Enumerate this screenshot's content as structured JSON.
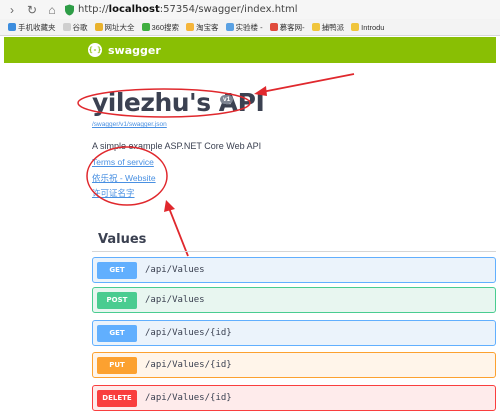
{
  "browser": {
    "url_prefix": "http://",
    "url_host": "localhost",
    "url_rest": ":57354/swagger/index.html"
  },
  "bookmarks": [
    {
      "label": "手机收藏夹",
      "color": "#3c8dde"
    },
    {
      "label": "谷歌",
      "color": "#cfcfcf"
    },
    {
      "label": "网址大全",
      "color": "#e9b22c"
    },
    {
      "label": "360搜索",
      "color": "#3fae3f"
    },
    {
      "label": "淘宝客",
      "color": "#f5b53a"
    },
    {
      "label": "实验楼 -",
      "color": "#5aa1e3"
    },
    {
      "label": "慕客网-",
      "color": "#e04b3c"
    },
    {
      "label": "捕鸭派",
      "color": "#f0c53c"
    },
    {
      "label": "Introdu",
      "color": "#f0c53c"
    }
  ],
  "topbar": {
    "brand": "swagger",
    "logo_glyph": "{-}",
    "color": "#89bf04"
  },
  "info": {
    "title": "yilezhu's API",
    "version": "v1",
    "spec_url": "/swagger/v1/swagger.json",
    "description": "A simple example ASP.NET Core Web API",
    "terms": "Terms of service",
    "contact": "依乐祝 - Website",
    "license": "许可证名字"
  },
  "section": {
    "title": "Values"
  },
  "operations": [
    {
      "method": "GET",
      "path": "/api/Values",
      "color": "#61affe",
      "bg": "#ebf3fb",
      "border": "#61affe"
    },
    {
      "method": "POST",
      "path": "/api/Values",
      "color": "#49cc90",
      "bg": "#e8f6f0",
      "border": "#49cc90"
    },
    {
      "method": "GET",
      "path": "/api/Values/{id}",
      "color": "#61affe",
      "bg": "#ebf3fb",
      "border": "#61affe"
    },
    {
      "method": "PUT",
      "path": "/api/Values/{id}",
      "color": "#fca130",
      "bg": "#fff5ea",
      "border": "#fca130"
    },
    {
      "method": "DELETE",
      "path": "/api/Values/{id}",
      "color": "#f93e3e",
      "bg": "#feebeb",
      "border": "#f93e3e"
    }
  ],
  "annotation_color": "#e0282d"
}
